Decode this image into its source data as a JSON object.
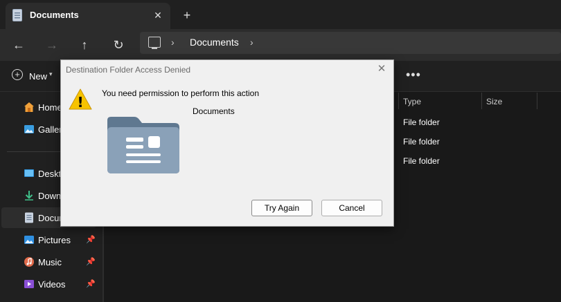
{
  "tab": {
    "title": "Documents",
    "close_glyph": "✕",
    "new_tab_glyph": "+"
  },
  "nav": {
    "back_glyph": "←",
    "forward_glyph": "→",
    "up_glyph": "↑",
    "refresh_glyph": "↻"
  },
  "address": {
    "segment": "Documents",
    "separator": "›"
  },
  "command_bar": {
    "new_label": "New",
    "more_glyph": "•••"
  },
  "sidebar": {
    "items": [
      {
        "label": "Home",
        "icon": "home-icon",
        "pinned": false
      },
      {
        "label": "Gallery",
        "icon": "gallery-icon",
        "pinned": false
      },
      {
        "label": "Desktop",
        "icon": "desktop-icon",
        "pinned": false
      },
      {
        "label": "Downloads",
        "icon": "download-icon",
        "pinned": false
      },
      {
        "label": "Documents",
        "icon": "documents-icon",
        "pinned": false,
        "selected": true
      },
      {
        "label": "Pictures",
        "icon": "pictures-icon",
        "pinned": true
      },
      {
        "label": "Music",
        "icon": "music-icon",
        "pinned": true
      },
      {
        "label": "Videos",
        "icon": "videos-icon",
        "pinned": true
      }
    ],
    "pin_glyph": "📌"
  },
  "columns": {
    "type": "Type",
    "size": "Size"
  },
  "rows": [
    {
      "type": "File folder"
    },
    {
      "type": "File folder"
    },
    {
      "type": "File folder"
    }
  ],
  "dialog": {
    "title": "Destination Folder Access Denied",
    "close_glyph": "✕",
    "message": "You need permission to perform this action",
    "folder_name": "Documents",
    "buttons": {
      "try_again": "Try Again",
      "cancel": "Cancel"
    },
    "warning_glyph": "!"
  },
  "colors": {
    "accent": "#4cc2ff",
    "warning": "#f7c300",
    "folder": "#7d94ab"
  }
}
